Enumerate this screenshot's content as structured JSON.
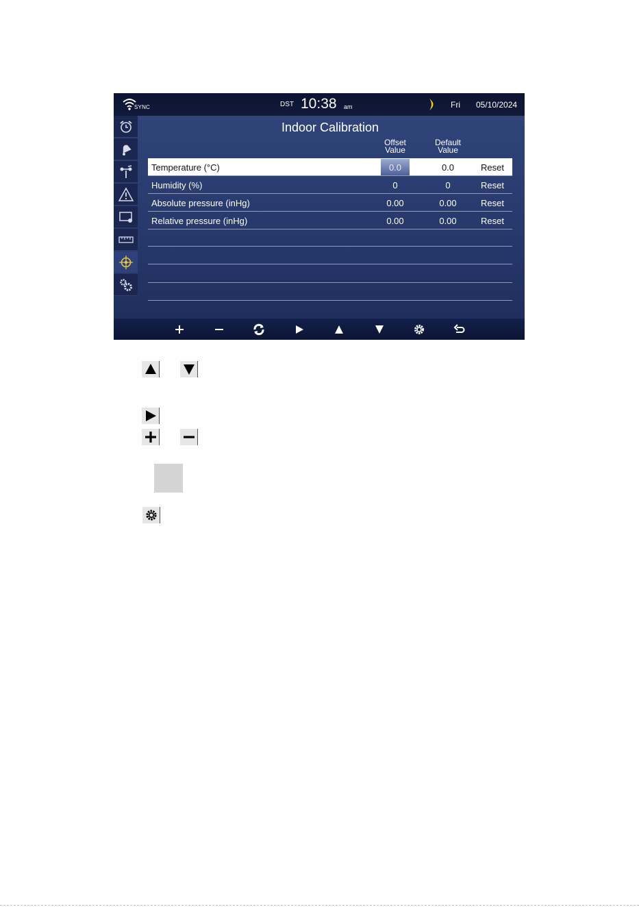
{
  "status": {
    "sync_label": "SYNC",
    "dst_label": "DST",
    "time": "10:38",
    "ampm": "am",
    "day": "Fri",
    "date": "05/10/2024"
  },
  "sidebar": {
    "items": [
      {
        "icon": "alarm-clock-icon"
      },
      {
        "icon": "bell-icon"
      },
      {
        "icon": "wind-sensor-icon"
      },
      {
        "icon": "warning-icon"
      },
      {
        "icon": "display-settings-icon"
      },
      {
        "icon": "ruler-icon"
      },
      {
        "icon": "calibration-crosshair-icon",
        "active": true
      },
      {
        "icon": "gears-icon"
      }
    ]
  },
  "page": {
    "title": "Indoor Calibration",
    "col_offset": "Offset\nValue",
    "col_default": "Default\nValue"
  },
  "rows": [
    {
      "name": "Temperature (°C)",
      "offset": "0.0",
      "default": "0.0",
      "reset": "Reset",
      "selected": true
    },
    {
      "name": "Humidity (%)",
      "offset": "0",
      "default": "0",
      "reset": "Reset"
    },
    {
      "name": "Absolute pressure (inHg)",
      "offset": "0.00",
      "default": "0.00",
      "reset": "Reset"
    },
    {
      "name": "Relative pressure (inHg)",
      "offset": "0.00",
      "default": "0.00",
      "reset": "Reset"
    }
  ],
  "bottom_bar": {
    "buttons": [
      "plus-icon",
      "minus-icon",
      "refresh-icon",
      "play-icon",
      "up-triangle-icon",
      "down-triangle-icon",
      "gear-icon",
      "back-icon"
    ]
  },
  "legend": {
    "icons": [
      "up-triangle-icon",
      "down-triangle-icon",
      "play-icon",
      "plus-icon",
      "minus-icon",
      "gear-icon"
    ]
  },
  "colors": {
    "screen_bg": "#2a3c70",
    "status_bar": "#0f1736",
    "highlight_row": "#ffffff",
    "moon": "#f3d21a",
    "active_icon": "#e8c640"
  }
}
